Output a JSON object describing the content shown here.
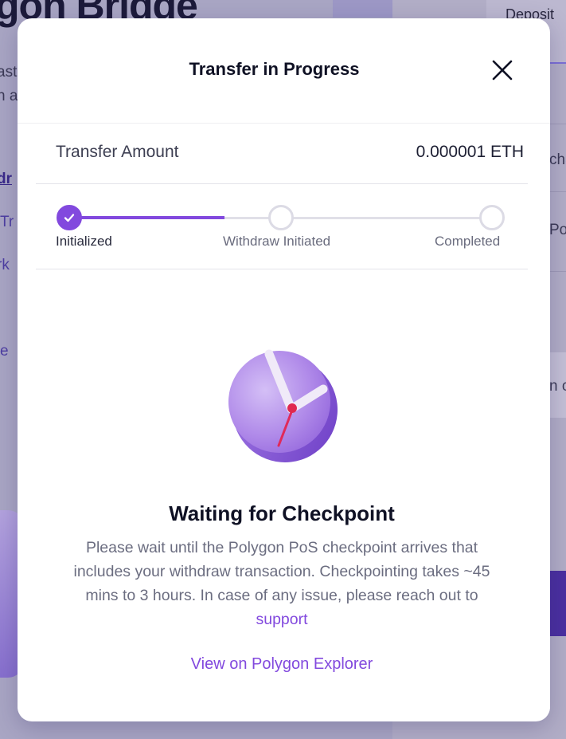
{
  "background": {
    "page_title": "gon Bridge",
    "deposit_tab": "Deposit",
    "snippets": [
      "ast",
      "n a",
      "dr",
      "Tr",
      "rk",
      "e",
      "cha",
      "Po",
      "n c"
    ]
  },
  "modal": {
    "title": "Transfer in Progress",
    "close_icon": "close-icon",
    "transfer": {
      "label": "Transfer Amount",
      "value": "0.000001 ETH"
    },
    "steps": [
      {
        "label": "Initialized",
        "status": "done"
      },
      {
        "label": "Withdraw Initiated",
        "status": "pending"
      },
      {
        "label": "Completed",
        "status": "pending"
      }
    ],
    "progress_fraction": 0.367,
    "illustration_icon": "clock-icon",
    "status": {
      "title": "Waiting for Checkpoint",
      "description": "Please wait until the Polygon PoS checkpoint arrives that includes your withdraw transaction. Checkpointing takes ~45 mins to 3 hours. In case of any issue, please reach out to ",
      "support_link": "support"
    },
    "explorer_link": "View on Polygon Explorer"
  },
  "colors": {
    "accent": "#8249de",
    "overlay": "#a9a6c4",
    "text_primary": "#0f1124",
    "text_secondary": "#6b6d80"
  }
}
